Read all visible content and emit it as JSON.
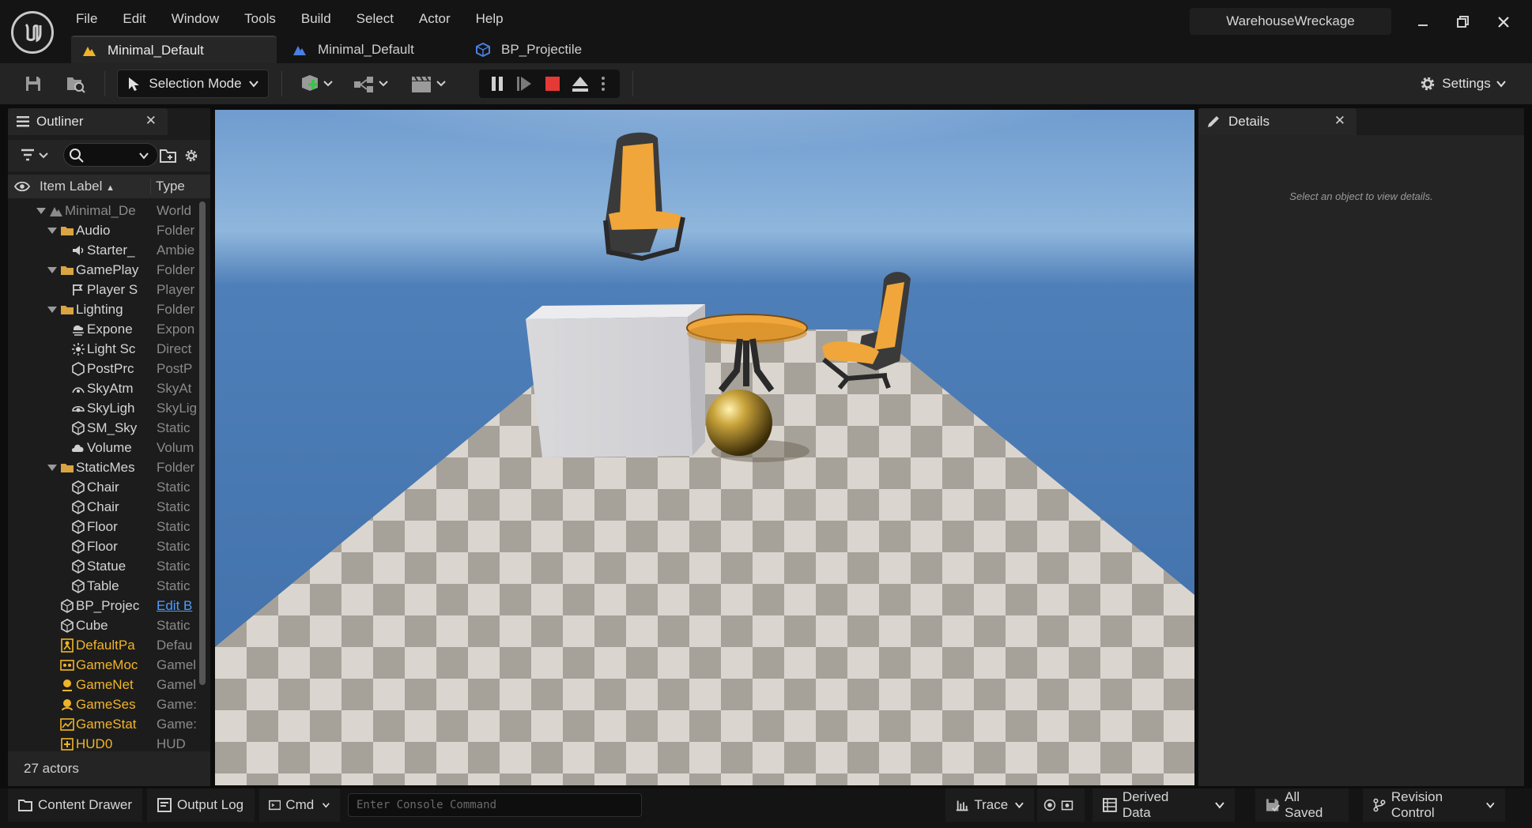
{
  "window": {
    "project_name": "WarehouseWreckage",
    "menu": [
      "File",
      "Edit",
      "Window",
      "Tools",
      "Build",
      "Select",
      "Actor",
      "Help"
    ],
    "tabs": [
      {
        "label": "Minimal_Default",
        "active": true
      },
      {
        "label": "Minimal_Default",
        "active": false
      },
      {
        "label": "BP_Projectile",
        "active": false
      }
    ]
  },
  "toolbar": {
    "selection_mode": "Selection Mode",
    "settings": "Settings"
  },
  "outliner": {
    "title": "Outliner",
    "col_label": "Item Label",
    "col_type": "Type",
    "status": "27 actors",
    "rows": [
      {
        "label": "Minimal_De",
        "type": "World",
        "level": 0,
        "expand": true,
        "icon": "world-icon",
        "dim": true
      },
      {
        "label": "Audio",
        "type": "Folder",
        "level": 1,
        "expand": true,
        "icon": "folder-icon"
      },
      {
        "label": "Starter_",
        "type": "Ambie",
        "level": 2,
        "icon": "speaker-icon"
      },
      {
        "label": "GamePlay",
        "type": "Folder",
        "level": 1,
        "expand": true,
        "icon": "folder-icon"
      },
      {
        "label": "Player S",
        "type": "Player",
        "level": 2,
        "icon": "player-start-icon"
      },
      {
        "label": "Lighting",
        "type": "Folder",
        "level": 1,
        "expand": true,
        "icon": "folder-icon"
      },
      {
        "label": "Expone",
        "type": "Expon",
        "level": 2,
        "icon": "fog-icon"
      },
      {
        "label": "Light Sc",
        "type": "Direct",
        "level": 2,
        "icon": "sun-icon"
      },
      {
        "label": "PostPrc",
        "type": "PostP",
        "level": 2,
        "icon": "postprocess-icon"
      },
      {
        "label": "SkyAtm",
        "type": "SkyAt",
        "level": 2,
        "icon": "sky-atmosphere-icon"
      },
      {
        "label": "SkyLigh",
        "type": "SkyLig",
        "level": 2,
        "icon": "skylight-icon"
      },
      {
        "label": "SM_Sky",
        "type": "Static",
        "level": 2,
        "icon": "static-mesh-icon"
      },
      {
        "label": "Volume",
        "type": "Volum",
        "level": 2,
        "icon": "cloud-icon"
      },
      {
        "label": "StaticMes",
        "type": "Folder",
        "level": 1,
        "expand": true,
        "icon": "folder-icon"
      },
      {
        "label": "Chair",
        "type": "Static",
        "level": 2,
        "icon": "static-mesh-icon"
      },
      {
        "label": "Chair",
        "type": "Static",
        "level": 2,
        "icon": "static-mesh-icon"
      },
      {
        "label": "Floor",
        "type": "Static",
        "level": 2,
        "icon": "static-mesh-icon"
      },
      {
        "label": "Floor",
        "type": "Static",
        "level": 2,
        "icon": "static-mesh-icon"
      },
      {
        "label": "Statue",
        "type": "Static",
        "level": 2,
        "icon": "static-mesh-icon"
      },
      {
        "label": "Table",
        "type": "Static",
        "level": 2,
        "icon": "static-mesh-icon"
      },
      {
        "label": "BP_Projec",
        "type": "Edit B",
        "level": 1,
        "icon": "static-mesh-icon",
        "link": true
      },
      {
        "label": "Cube",
        "type": "Static",
        "level": 1,
        "icon": "static-mesh-icon"
      },
      {
        "label": "DefaultPa",
        "type": "Defau",
        "level": 1,
        "icon": "pawn-icon",
        "yellow": true
      },
      {
        "label": "GameMoc",
        "type": "Gamel",
        "level": 1,
        "icon": "gamemode-icon",
        "yellow": true
      },
      {
        "label": "GameNet",
        "type": "Gamel",
        "level": 1,
        "icon": "network-icon",
        "yellow": true
      },
      {
        "label": "GameSes",
        "type": "Game:",
        "level": 1,
        "icon": "session-icon",
        "yellow": true
      },
      {
        "label": "GameStat",
        "type": "Game:",
        "level": 1,
        "icon": "gamestate-icon",
        "yellow": true
      },
      {
        "label": "HUD0",
        "type": "HUD",
        "level": 1,
        "icon": "hud-icon",
        "yellow": true
      }
    ]
  },
  "details": {
    "title": "Details",
    "empty_text": "Select an object to view details."
  },
  "statusbar": {
    "content_drawer": "Content Drawer",
    "output_log": "Output Log",
    "cmd": "Cmd",
    "console_placeholder": "Enter Console Command",
    "trace": "Trace",
    "derived_data": "Derived Data",
    "all_saved": "All Saved",
    "revision_control": "Revision Control"
  },
  "colors": {
    "accent_yellow": "#f0b429",
    "link_blue": "#4f9cff",
    "stop_red": "#e53935"
  }
}
